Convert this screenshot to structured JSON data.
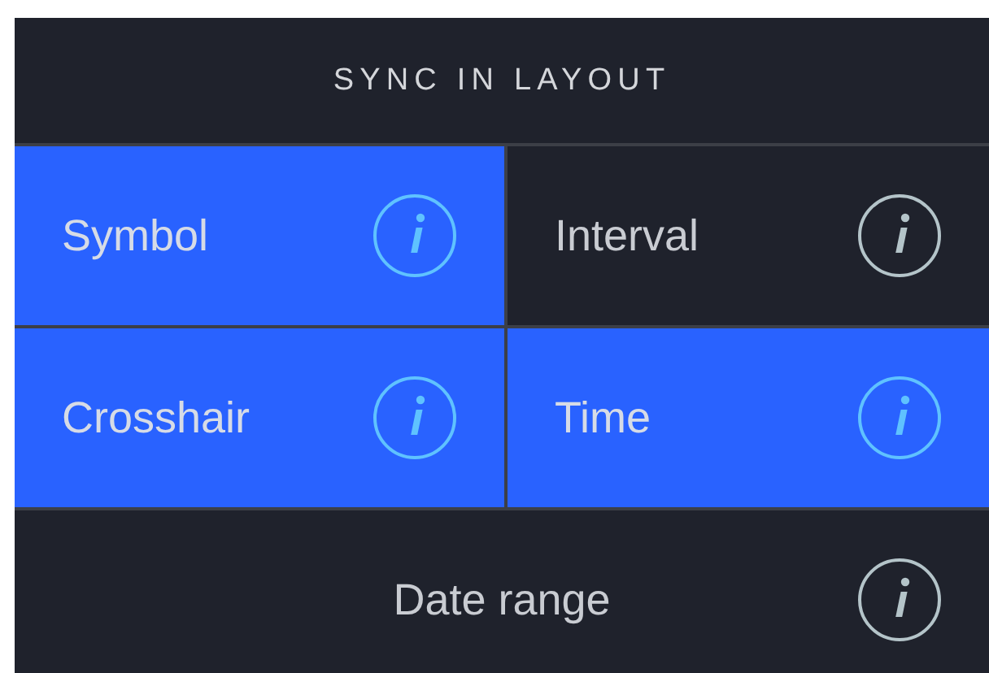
{
  "title": "SYNC IN LAYOUT",
  "options": [
    {
      "kind": "cell",
      "label": "Symbol",
      "selected": true
    },
    {
      "kind": "cell",
      "label": "Interval",
      "selected": false
    },
    {
      "kind": "cell",
      "label": "Crosshair",
      "selected": true
    },
    {
      "kind": "cell",
      "label": "Time",
      "selected": true
    },
    {
      "kind": "wide",
      "label": "Date range",
      "selected": false
    }
  ]
}
